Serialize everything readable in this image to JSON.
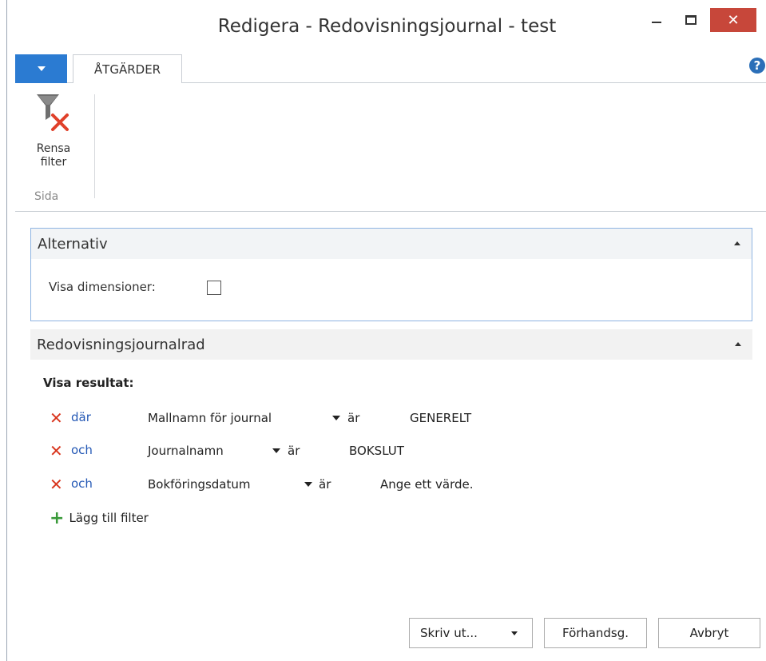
{
  "window": {
    "title": "Redigera - Redovisningsjournal - test"
  },
  "ribbon": {
    "tab": "ÅTGÄRDER",
    "help": "?",
    "clear_filter_label_1": "Rensa",
    "clear_filter_label_2": "filter",
    "group_label": "Sida"
  },
  "options": {
    "header": "Alternativ",
    "show_dimensions_label": "Visa dimensioner:",
    "show_dimensions_checked": false
  },
  "journal_line": {
    "header": "Redovisningsjournalrad",
    "show_results_label": "Visa resultat:",
    "filters": [
      {
        "conjunction": "där",
        "field": "Mallnamn för journal",
        "operator": "är",
        "value": "GENERELT"
      },
      {
        "conjunction": "och",
        "field": "Journalnamn",
        "operator": "är",
        "value": "BOKSLUT"
      },
      {
        "conjunction": "och",
        "field": "Bokföringsdatum",
        "operator": "är",
        "value": "Ange ett värde."
      }
    ],
    "add_filter_label": "Lägg till filter"
  },
  "buttons": {
    "print": "Skriv ut...",
    "preview": "Förhandsg.",
    "cancel": "Avbryt"
  },
  "colors": {
    "accent": "#2b7bd2",
    "close": "#c7473a",
    "remove": "#d9361e",
    "conjunction": "#2458b5",
    "add": "#3a9a3a"
  }
}
